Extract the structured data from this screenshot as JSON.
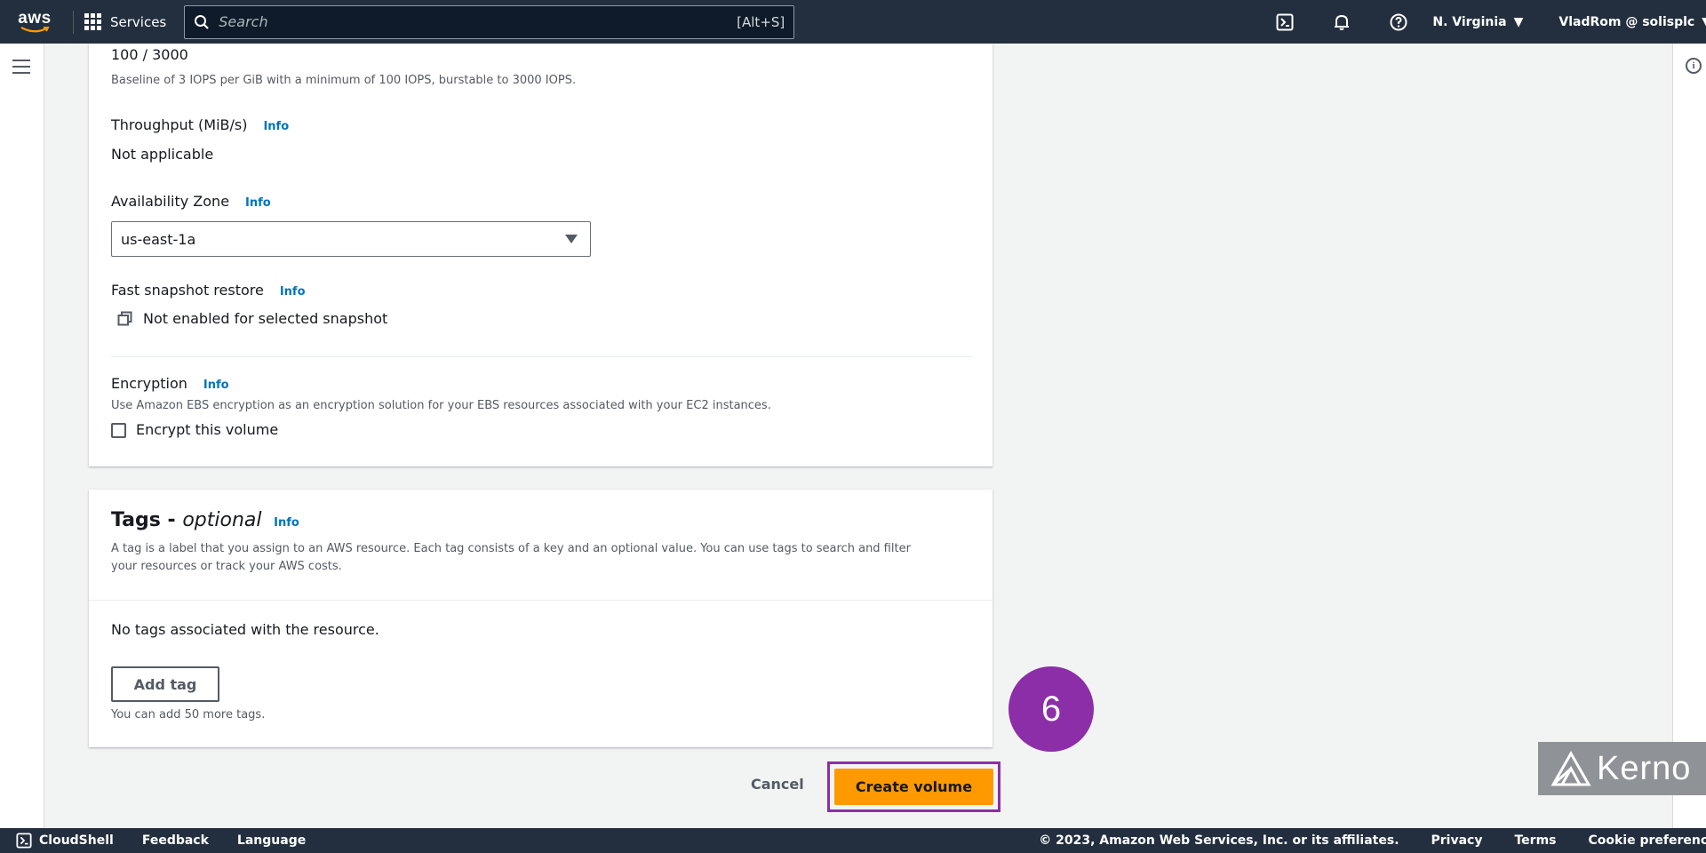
{
  "nav": {
    "logo_text": "aws",
    "services_label": "Services",
    "search_placeholder": "Search",
    "search_shortcut": "[Alt+S]",
    "region": "N. Virginia",
    "user": "VladRom @ solisplc"
  },
  "volume": {
    "iops_value": "100 / 3000",
    "iops_hint": "Baseline of 3 IOPS per GiB with a minimum of 100 IOPS, burstable to 3000 IOPS.",
    "throughput_label": "Throughput (MiB/s)",
    "throughput_value": "Not applicable",
    "az_label": "Availability Zone",
    "az_value": "us-east-1a",
    "fsr_label": "Fast snapshot restore",
    "fsr_value": "Not enabled for selected snapshot",
    "encryption_label": "Encryption",
    "encryption_hint": "Use Amazon EBS encryption as an encryption solution for your EBS resources associated with your EC2 instances.",
    "encrypt_checkbox_label": "Encrypt this volume",
    "info": "Info"
  },
  "tags": {
    "title": "Tags -",
    "title_optional": "optional",
    "info": "Info",
    "description_line1": "A tag is a label that you assign to an AWS resource. Each tag consists of a key and an optional value. You can use tags to search and filter",
    "description_line2": "your resources or track your AWS costs.",
    "empty_text": "No tags associated with the resource.",
    "add_button": "Add tag",
    "remaining_hint": "You can add 50 more tags."
  },
  "actions": {
    "cancel": "Cancel",
    "create": "Create volume"
  },
  "overlay": {
    "step_number": "6",
    "watermark": "Kerno",
    "step_color": "#8c2ea8"
  },
  "footer": {
    "cloudshell": "CloudShell",
    "feedback": "Feedback",
    "language": "Language",
    "copyright": "© 2023, Amazon Web Services, Inc. or its affiliates.",
    "privacy": "Privacy",
    "terms": "Terms",
    "cookies": "Cookie preferences"
  },
  "colors": {
    "nav_bg": "#232f3e",
    "link": "#0073bb",
    "primary_button": "#ff9900"
  }
}
